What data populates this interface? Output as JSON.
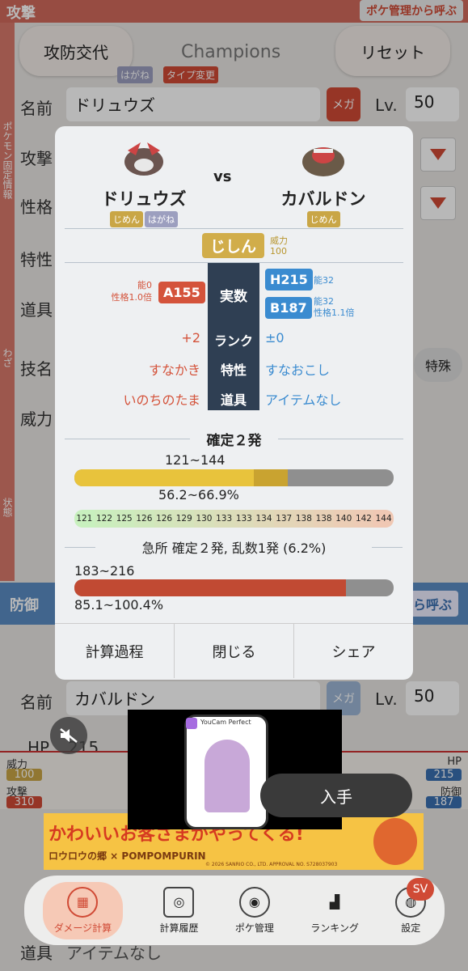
{
  "background": {
    "attack_section": "攻撃",
    "import_button": "ポケ管理から呼ぶ",
    "swap_button": "攻防交代",
    "format": "Champions",
    "reset_button": "リセット",
    "tags": [
      "はがね",
      "タイプ変更"
    ],
    "sidebar_label": "ポケモン固定情報",
    "labels": {
      "name": "名前",
      "attack": "攻撃",
      "nature": "性格",
      "ability": "特性",
      "item": "道具",
      "move": "技名",
      "power": "威力"
    },
    "name_value": "ドリュウズ",
    "mega_label": "メガ",
    "level_label": "Lv.",
    "level_value": "50",
    "special_label": "特殊",
    "move_side": "わざ",
    "status_side": "状態",
    "defense_section": "防御",
    "defense_import": "ら呼ぶ",
    "def_name_value": "カバルドン",
    "def_level": "50",
    "hp_label": "HP",
    "hp_value": "215",
    "def_item_label": "道具",
    "def_item_value": "アイテムなし",
    "strip": {
      "power_label": "威力",
      "power": "100",
      "atk_label": "攻撃",
      "atk": "310",
      "hp_label": "HP",
      "hp": "215",
      "def_label": "防御",
      "def": "187"
    }
  },
  "modal": {
    "attacker": {
      "name": "ドリュウズ",
      "types": [
        "じめん",
        "はがね"
      ]
    },
    "vs": "vs",
    "defender": {
      "name": "カバルドン",
      "types": [
        "じめん"
      ]
    },
    "move": {
      "name": "じしん",
      "power_label": "威力",
      "power": "100"
    },
    "stats": {
      "center_label": "実数",
      "atk_box": "A155",
      "atk_note1": "能0",
      "atk_note2": "性格1.0倍",
      "h_box": "H215",
      "h_note": "能32",
      "b_box": "B187",
      "b_note1": "能32",
      "b_note2": "性格1.1倍"
    },
    "rows": [
      {
        "left": "+2",
        "mid": "ランク",
        "right": "±0"
      },
      {
        "left": "すなかき",
        "mid": "特性",
        "right": "すなおこし"
      },
      {
        "left": "いのちのたま",
        "mid": "道具",
        "right": "アイテムなし"
      }
    ],
    "result": {
      "title": "確定２発",
      "range": "121~144",
      "percent": "56.2~66.9%",
      "bar_min_pct": 56.2,
      "bar_max_pct": 66.9,
      "rolls": [
        "121",
        "122",
        "125",
        "126",
        "126",
        "129",
        "130",
        "133",
        "133",
        "134",
        "137",
        "138",
        "138",
        "140",
        "142",
        "144"
      ]
    },
    "crit": {
      "title": "急所 確定２発, 乱数1発 (6.2%)",
      "range": "183~216",
      "percent": "85.1~100.4%",
      "bar_pct": 85.1
    },
    "buttons": {
      "process": "計算過程",
      "close": "閉じる",
      "share": "シェア"
    }
  },
  "ad": {
    "brand": "YouCam Perfect",
    "get_button": "入手",
    "banner_text": "かわいいお客さまがやってくる!",
    "banner_sub": "ロウロウの郷 × POMPOMPURIN",
    "copyright": "© 2026 SANRIO CO., LTD. APPROVAL NO. S728037903"
  },
  "tabs": [
    {
      "label": "ダメージ計算",
      "icon": "calculator-icon"
    },
    {
      "label": "計算履歴",
      "icon": "history-icon"
    },
    {
      "label": "ポケ管理",
      "icon": "pokemon-box-icon"
    },
    {
      "label": "ランキング",
      "icon": "podium-icon"
    },
    {
      "label": "設定",
      "icon": "settings-icon"
    }
  ],
  "sv_badge": "SV"
}
